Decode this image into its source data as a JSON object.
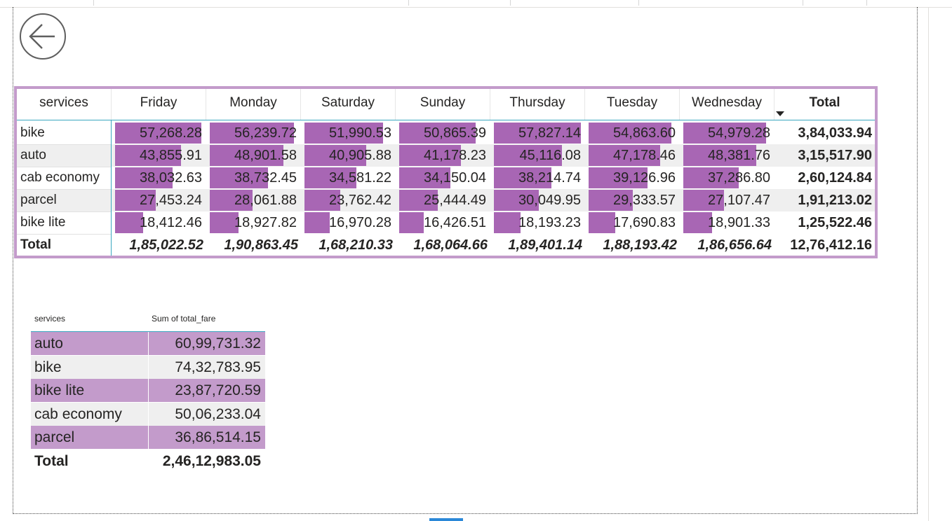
{
  "matrix": {
    "row_header": "services",
    "columns": [
      "Friday",
      "Monday",
      "Saturday",
      "Sunday",
      "Thursday",
      "Tuesday",
      "Wednesday"
    ],
    "total_label": "Total",
    "rows": [
      {
        "label": "bike",
        "values": [
          "57,268.28",
          "56,239.72",
          "51,990.53",
          "50,865.39",
          "57,827.14",
          "54,863.60",
          "54,979.28"
        ],
        "total": "3,84,033.94"
      },
      {
        "label": "auto",
        "values": [
          "43,855.91",
          "48,901.58",
          "40,905.88",
          "41,178.23",
          "45,116.08",
          "47,178.46",
          "48,381.76"
        ],
        "total": "3,15,517.90"
      },
      {
        "label": "cab economy",
        "values": [
          "38,032.63",
          "38,732.45",
          "34,581.22",
          "34,150.04",
          "38,214.74",
          "39,126.96",
          "37,286.80"
        ],
        "total": "2,60,124.84"
      },
      {
        "label": "parcel",
        "values": [
          "27,453.24",
          "28,061.88",
          "23,762.42",
          "25,444.49",
          "30,049.95",
          "29,333.57",
          "27,107.47"
        ],
        "total": "1,91,213.02"
      },
      {
        "label": "bike lite",
        "values": [
          "18,412.46",
          "18,927.82",
          "16,970.28",
          "16,426.51",
          "18,193.23",
          "17,690.83",
          "18,901.33"
        ],
        "total": "1,25,522.46"
      }
    ],
    "totals": {
      "label": "Total",
      "values": [
        "1,85,022.52",
        "1,90,863.45",
        "1,68,210.33",
        "1,68,064.66",
        "1,89,401.14",
        "1,88,193.42",
        "1,86,656.64"
      ],
      "grand": "12,76,412.16"
    },
    "bar_fractions": [
      [
        0.99,
        0.97,
        0.9,
        0.88,
        1.0,
        0.95,
        0.95
      ],
      [
        0.76,
        0.85,
        0.71,
        0.71,
        0.78,
        0.82,
        0.84
      ],
      [
        0.66,
        0.67,
        0.6,
        0.59,
        0.66,
        0.68,
        0.64
      ],
      [
        0.47,
        0.49,
        0.41,
        0.44,
        0.52,
        0.51,
        0.47
      ],
      [
        0.32,
        0.33,
        0.29,
        0.28,
        0.31,
        0.31,
        0.33
      ]
    ],
    "bar_color": "#a866b4",
    "border_color": "#c39bcb"
  },
  "summary": {
    "col1_header": "services",
    "col2_header": "Sum of total_fare",
    "rows": [
      {
        "name": "auto",
        "value": "60,99,731.32"
      },
      {
        "name": "bike",
        "value": "74,32,783.95"
      },
      {
        "name": "bike lite",
        "value": "23,87,720.59"
      },
      {
        "name": "cab economy",
        "value": "50,06,233.04"
      },
      {
        "name": "parcel",
        "value": "36,86,514.15"
      }
    ],
    "total_label": "Total",
    "total_value": "2,46,12,983.05",
    "band_color": "#c39bcb"
  }
}
